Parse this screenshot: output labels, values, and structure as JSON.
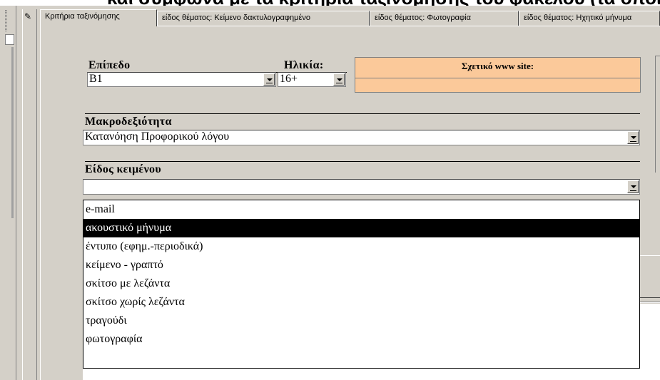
{
  "window_title": "και σύμφωνα με τα κριτήρια ταξινόμησης του φακέλου (τα οποία)",
  "tabs": [
    "Κριτήρια ταξινόμησης",
    "είδος θέματος: Κείμενο δακτυλογραφημένο",
    "είδος θέματος: Φωτογραφία",
    "είδος θέματος: Ηχητικό μήνυμα"
  ],
  "active_tab": 0,
  "form": {
    "level": {
      "label": "Επίπεδο",
      "value": "B1"
    },
    "age": {
      "label": "Ηλικία:",
      "value": "16+"
    },
    "website": {
      "label": "Σχετικό www site:",
      "value": ""
    },
    "macroskill": {
      "label": "Μακροδεξιότητα",
      "value": "Κατανόηση Προφορικού λόγου"
    },
    "text_type": {
      "label": "Είδος κειμένου",
      "value": ""
    }
  },
  "dropdown": {
    "items": [
      "e-mail",
      "ακουστικό μήνυμα",
      "έντυπο (εφημ.-περιοδικά)",
      "κείμενο - γραπτό",
      "σκίτσο με λεζάντα",
      "σκίτσο χωρίς λεζάντα",
      "τραγούδι",
      "φωτογραφία"
    ],
    "selected_index": 1
  },
  "colors": {
    "form_bg": "#d4d0c8",
    "website_bg": "#fbc99a",
    "selected_bg": "#000000"
  },
  "icons": {
    "record_selector": "pencil-icon",
    "dropdown": "chevron-down-icon"
  }
}
